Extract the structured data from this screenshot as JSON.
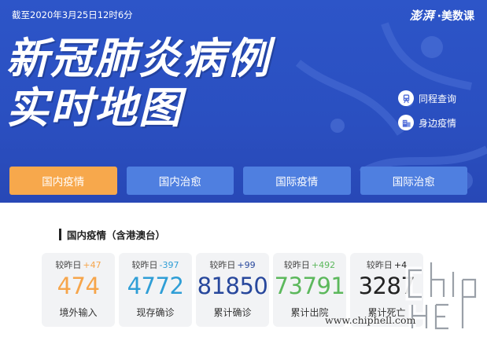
{
  "header": {
    "date": "截至2020年3月25日12时6分",
    "brand_logo": "澎湃",
    "brand_name": "·美数课",
    "title_line1": "新冠肺炎病例",
    "title_line2": "实时地图",
    "links": [
      {
        "label": "同程查询",
        "icon": "train-icon"
      },
      {
        "label": "身边疫情",
        "icon": "building-icon"
      }
    ]
  },
  "tabs": [
    {
      "label": "国内疫情",
      "active": true
    },
    {
      "label": "国内治愈",
      "active": false
    },
    {
      "label": "国际疫情",
      "active": false
    },
    {
      "label": "国际治愈",
      "active": false
    }
  ],
  "stats": {
    "title": "国内疫情（含港澳台）",
    "delta_prefix": "较昨日",
    "cards": [
      {
        "delta": "+47",
        "value": "474",
        "label": "境外输入",
        "color": "#f6a54b"
      },
      {
        "delta": "-397",
        "value": "4772",
        "label": "现存确诊",
        "color": "#2f9ed6"
      },
      {
        "delta": "+99",
        "value": "81850",
        "label": "累计确诊",
        "color": "#27479c"
      },
      {
        "delta": "+492",
        "value": "73791",
        "label": "累计出院",
        "color": "#5cb85c"
      },
      {
        "delta": "+4",
        "value": "3287",
        "label": "累计死亡",
        "color": "#222222"
      }
    ]
  },
  "watermark": {
    "logo": "chiphell",
    "url": "www.chiphell.com"
  },
  "colors": {
    "hero_bg": "#2a50c2",
    "tab_bg": "#4f7fe0",
    "tab_active": "#f7a84c"
  }
}
